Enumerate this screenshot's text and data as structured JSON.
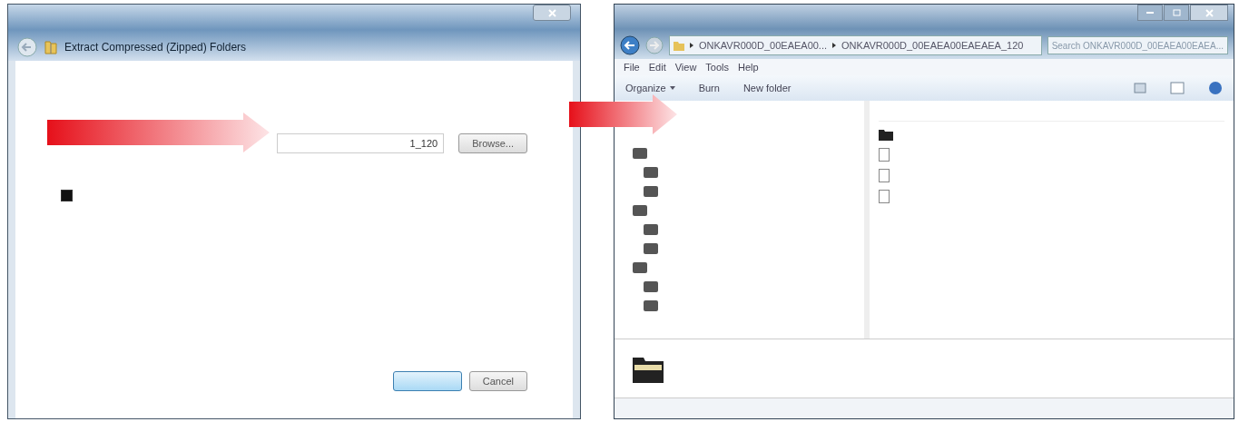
{
  "extract_dialog": {
    "title": "Extract Compressed (Zipped) Folders",
    "field_value": "1_120",
    "show_files_checkbox": {
      "checked": true
    },
    "buttons": [
      {
        "label": "Browse...",
        "kind": "browse"
      },
      {
        "kind": "default"
      },
      {
        "label": "Cancel",
        "kind": "plain"
      }
    ]
  },
  "explorer": {
    "breadcrumbs": [
      "ONKAVR000D_00EAEA00...",
      "ONKAVR000D_00EAEA00EAEAEA_120"
    ],
    "search": {
      "placeholder": "Search ONKAVR000D_00EAEA00EAEA..."
    },
    "menu": [
      "File",
      "Edit",
      "View",
      "Tools",
      "Help"
    ],
    "toolbar": [
      {
        "label": "Organize",
        "dropdown": true
      },
      {
        "label": "Burn",
        "dropdown": false
      },
      {
        "label": "New folder",
        "dropdown": false
      }
    ],
    "files": [
      {
        "kind": "folder"
      },
      {
        "kind": "file"
      },
      {
        "kind": "file"
      },
      {
        "kind": "file"
      }
    ]
  }
}
